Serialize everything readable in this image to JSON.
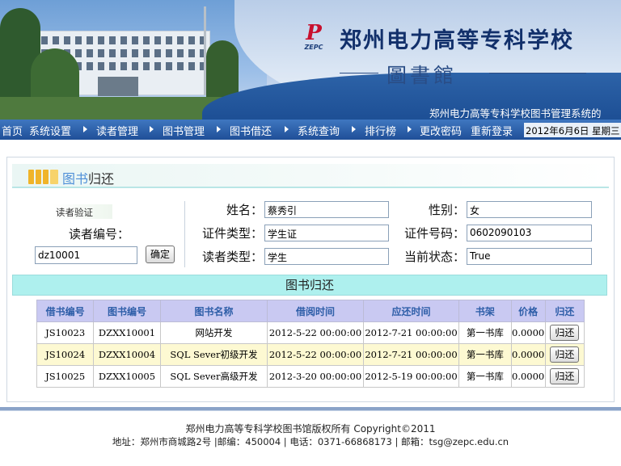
{
  "header": {
    "logo_mark": "P",
    "logo_sub": "ZEPC",
    "school_name": "郑州电力高等专科学校",
    "library_name": "圖書館",
    "marquee": "郑州电力高等专科学校图书管理系统的"
  },
  "nav": {
    "items": [
      "首页",
      "系统设置",
      "读者管理",
      "图书管理",
      "图书借还",
      "系统查询",
      "排行榜",
      "更改密码",
      "重新登录"
    ],
    "date": "2012年6月6日 星期三"
  },
  "page": {
    "title_highlight": "图书",
    "title_rest": "归还"
  },
  "reader": {
    "verify_label": "读者验证",
    "reader_no_label": "读者编号：",
    "reader_no_value": "dz10001",
    "confirm_label": "确定",
    "name_label": "姓名：",
    "name_value": "蔡秀引",
    "gender_label": "性别：",
    "gender_value": "女",
    "id_type_label": "证件类型：",
    "id_type_value": "学生证",
    "id_no_label": "证件号码：",
    "id_no_value": "0602090103",
    "reader_type_label": "读者类型：",
    "reader_type_value": "学生",
    "status_label": "当前状态：",
    "status_value": "True"
  },
  "section_title": "图书归还",
  "table": {
    "headers": [
      "借书编号",
      "图书编号",
      "图书名称",
      "借阅时间",
      "应还时间",
      "书架",
      "价格",
      "归还"
    ],
    "rows": [
      [
        "JS10023",
        "DZXX10001",
        "网站开发",
        "2012-5-22 00:00:00",
        "2012-7-21 00:00:00",
        "第一书库",
        "0.0000",
        "归还"
      ],
      [
        "JS10024",
        "DZXX10004",
        "SQL Sever初级开发",
        "2012-5-22 00:00:00",
        "2012-7-21 00:00:00",
        "第一书库",
        "0.0000",
        "归还"
      ],
      [
        "JS10025",
        "DZXX10005",
        "SQL Sever高级开发",
        "2012-3-20 00:00:00",
        "2012-5-19 00:00:00",
        "第一书库",
        "0.0000",
        "归还"
      ]
    ]
  },
  "footer": {
    "copyright": "郑州电力高等专科学校图书馆版权所有  Copyright©2011",
    "contact": "地址：郑州市商城路2号 |邮编：450004 | 电话：0371-66868173 | 邮箱：tsg@zepc.edu.cn"
  },
  "colors": {
    "nav_bg": "#2a5ea8",
    "section_bg": "#aef0ee",
    "table_header_bg": "#c9c9f2",
    "table_header_text": "#2e5ea8",
    "alt_row_bg": "#fdf9d2"
  }
}
